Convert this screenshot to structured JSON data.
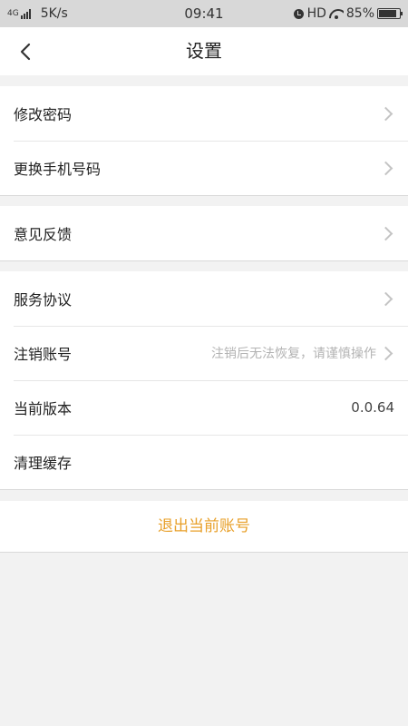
{
  "status_bar": {
    "network": "4G",
    "speed": "5K/s",
    "time": "09:41",
    "hd": "HD",
    "battery_percent": "85%",
    "battery_level": 0.85
  },
  "nav": {
    "back_icon": "chevron-left-icon",
    "title": "设置"
  },
  "groups": [
    {
      "items": [
        {
          "label": "修改密码"
        },
        {
          "label": "更换手机号码"
        }
      ]
    },
    {
      "items": [
        {
          "label": "意见反馈"
        }
      ]
    },
    {
      "items": [
        {
          "label": "服务协议"
        },
        {
          "label": "注销账号",
          "hint": "注销后无法恢复，请谨慎操作"
        },
        {
          "label": "当前版本",
          "value": "0.0.64"
        },
        {
          "label": "清理缓存"
        }
      ]
    }
  ],
  "logout": {
    "label": "退出当前账号"
  },
  "colors": {
    "accent": "#e8a02a",
    "background": "#f2f2f2",
    "hint_text": "#b3b3b3"
  }
}
